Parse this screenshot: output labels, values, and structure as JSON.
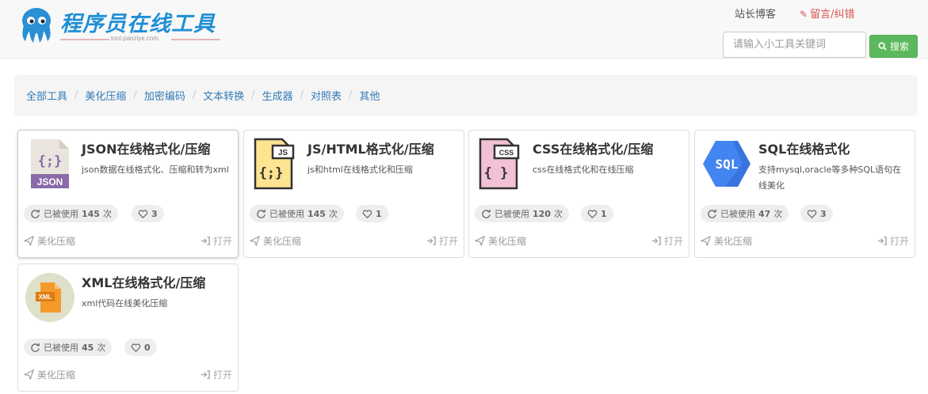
{
  "header": {
    "logo_title": "程序员在线工具",
    "logo_url": "tool.panziye.com",
    "blog_link": "站长博客",
    "feedback_link": "留言/纠错",
    "search": {
      "placeholder": "请输入小工具关键词",
      "button_label": "搜索"
    }
  },
  "breadcrumb": {
    "items": [
      "全部工具",
      "美化压缩",
      "加密编码",
      "文本转换",
      "生成器",
      "对照表",
      "其他"
    ]
  },
  "used_prefix": "已被使用",
  "used_suffix": "次",
  "open_label": "打开",
  "tools": [
    {
      "icon": "json-file-icon",
      "title": "JSON在线格式化/压缩",
      "desc": "json数据在线格式化、压缩和转为xml",
      "uses": "145",
      "likes": "3",
      "category": "美化压缩"
    },
    {
      "icon": "js-file-icon",
      "title": "JS/HTML格式化/压缩",
      "desc": "js和html在线格式化和压缩",
      "uses": "145",
      "likes": "1",
      "category": "美化压缩"
    },
    {
      "icon": "css-file-icon",
      "title": "CSS在线格式化/压缩",
      "desc": "css在线格式化和在线压缩",
      "uses": "120",
      "likes": "1",
      "category": "美化压缩"
    },
    {
      "icon": "sql-hexagon-icon",
      "title": "SQL在线格式化",
      "desc": "支持mysql,oracle等多种SQL语句在线美化",
      "uses": "47",
      "likes": "3",
      "category": "美化压缩"
    },
    {
      "icon": "xml-file-icon",
      "title": "XML在线格式化/压缩",
      "desc": "xml代码在线美化压缩",
      "uses": "45",
      "likes": "0",
      "category": "美化压缩"
    }
  ],
  "colors": {
    "brand": "#1e8fd6",
    "search_button": "#5cb85c",
    "link": "#337ab7",
    "feedback": "#d9534f"
  }
}
